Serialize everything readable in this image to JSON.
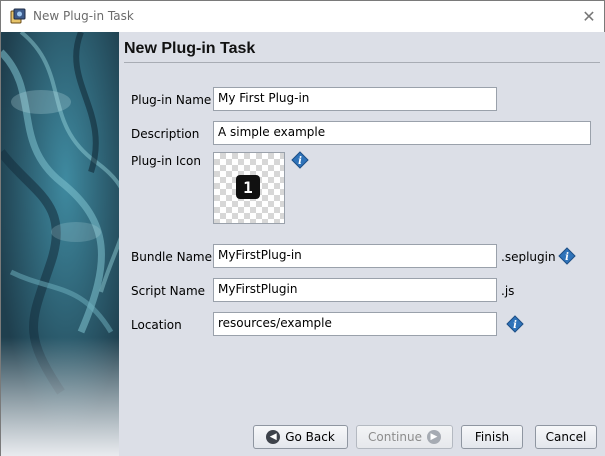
{
  "window": {
    "title": "New Plug-in Task",
    "close_glyph": "✕"
  },
  "page": {
    "heading": "New Plug-in Task"
  },
  "form": {
    "plugin_name": {
      "label": "Plug-in Name",
      "value": "My First Plug-in"
    },
    "description": {
      "label": "Description",
      "value": "A simple example"
    },
    "plugin_icon": {
      "label": "Plug-in Icon",
      "glyph": "1"
    },
    "bundle_name": {
      "label": "Bundle Name",
      "value": "MyFirstPlug-in",
      "suffix": ".seplugin"
    },
    "script_name": {
      "label": "Script Name",
      "value": "MyFirstPlugin",
      "suffix": ".js"
    },
    "location": {
      "label": "Location",
      "value": "resources/example"
    }
  },
  "buttons": {
    "go_back": "Go Back",
    "continue": "Continue",
    "finish": "Finish",
    "cancel": "Cancel"
  },
  "icons": {
    "app": "app-icon",
    "info": "info-icon",
    "back": "arrow-left-icon",
    "continue": "arrow-right-icon",
    "close": "close-icon"
  },
  "colors": {
    "panel_bg": "#dcdfe7",
    "info_blue": "#2f73b9",
    "button_icon": "#3e434b"
  }
}
